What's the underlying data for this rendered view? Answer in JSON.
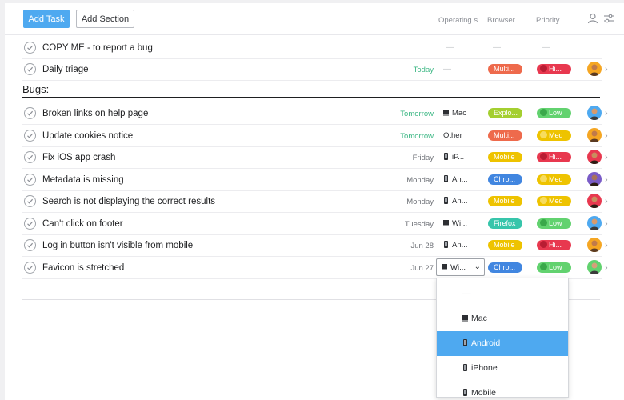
{
  "toolbar": {
    "add_task": "Add Task",
    "add_section": "Add Section"
  },
  "columns": {
    "os": "Operating s...",
    "browser": "Browser",
    "priority": "Priority"
  },
  "colors": {
    "accent": "#4ea9f0",
    "green_text": "#3cb784",
    "multi": "#ee6a4c",
    "explorer": "#a4cf30",
    "mobile": "#eec300",
    "chrome": "#4186e0",
    "firefox": "#37c5ab",
    "high": "#e8384f",
    "low": "#62d26f",
    "med": "#eec300"
  },
  "top_rows": [
    {
      "name": "COPY ME - to report a bug",
      "due": "",
      "os": "—",
      "browser": "—",
      "priority": "—"
    },
    {
      "name": "Daily triage",
      "due": "Today",
      "os": "—",
      "browser": "Multi...",
      "browser_color": "#ee6a4c",
      "priority": "Hi...",
      "priority_color": "#e8384f"
    }
  ],
  "section": {
    "title": "Bugs:"
  },
  "bug_rows": [
    {
      "name": "Broken links on help page",
      "due": "Tomorrow",
      "os": "Mac",
      "os_icon": "laptop-icon",
      "browser": "Explo...",
      "browser_color": "#a4cf30",
      "priority": "Low",
      "priority_color": "#62d26f"
    },
    {
      "name": "Update cookies notice",
      "due": "Tomorrow",
      "os": "Other",
      "os_icon": "",
      "browser": "Multi...",
      "browser_color": "#ee6a4c",
      "priority": "Med",
      "priority_color": "#eec300"
    },
    {
      "name": "Fix iOS app crash",
      "due": "Friday",
      "os": "iP...",
      "os_icon": "phone-icon",
      "browser": "Mobile",
      "browser_color": "#eec300",
      "priority": "Hi...",
      "priority_color": "#e8384f"
    },
    {
      "name": "Metadata is missing",
      "due": "Monday",
      "os": "An...",
      "os_icon": "phone-icon",
      "browser": "Chro...",
      "browser_color": "#4186e0",
      "priority": "Med",
      "priority_color": "#eec300"
    },
    {
      "name": "Search is not displaying the correct results",
      "due": "Monday",
      "os": "An...",
      "os_icon": "phone-icon",
      "browser": "Mobile",
      "browser_color": "#eec300",
      "priority": "Med",
      "priority_color": "#eec300"
    },
    {
      "name": "Can't click on footer",
      "due": "Tuesday",
      "os": "Wi...",
      "os_icon": "laptop-icon",
      "browser": "Firefox",
      "browser_color": "#37c5ab",
      "priority": "Low",
      "priority_color": "#62d26f"
    },
    {
      "name": "Log in button isn't visible from mobile",
      "due": "Jun 28",
      "os": "An...",
      "os_icon": "phone-icon",
      "browser": "Mobile",
      "browser_color": "#eec300",
      "priority": "Hi...",
      "priority_color": "#e8384f"
    },
    {
      "name": "Favicon is stretched",
      "due": "Jun 27",
      "os": "Wi...",
      "os_icon": "laptop-icon",
      "browser": "Chro...",
      "browser_color": "#4186e0",
      "priority": "Low",
      "priority_color": "#62d26f"
    }
  ],
  "os_select": {
    "value": "Wi..."
  },
  "os_dropdown": {
    "options": [
      {
        "label": "—",
        "icon": ""
      },
      {
        "label": "Mac",
        "icon": "laptop-icon"
      },
      {
        "label": "Android",
        "icon": "phone-icon",
        "selected": true
      },
      {
        "label": "iPhone",
        "icon": "phone-icon"
      },
      {
        "label": "Mobile",
        "icon": "phone-icon"
      }
    ]
  }
}
